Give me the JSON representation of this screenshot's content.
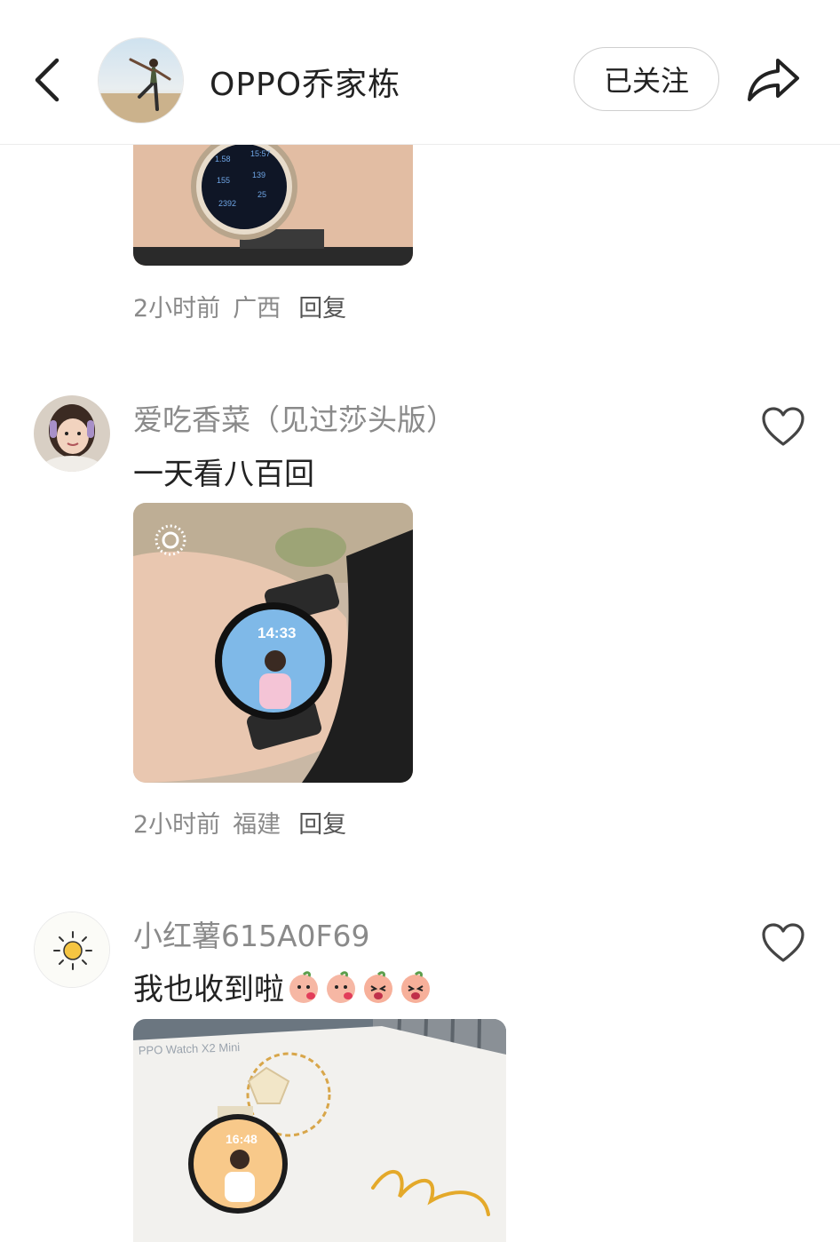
{
  "header": {
    "username": "OPPO乔家栋",
    "follow_label": "已关注"
  },
  "post_top": {
    "time": "2小时前",
    "location": "广西",
    "reply_label": "回复"
  },
  "comments": [
    {
      "username": "爱吃香菜（见过莎头版）",
      "text": "一天看八百回",
      "time": "2小时前",
      "location": "福建",
      "reply_label": "回复"
    },
    {
      "username": "小红薯615A0F69",
      "text": "我也收到啦"
    }
  ],
  "colors": {
    "meta_gray": "#8a8a8a",
    "text_dark": "#222222",
    "divider": "#ececec"
  },
  "icons": [
    "back-icon",
    "share-icon",
    "heart-icon",
    "sun-icon"
  ]
}
